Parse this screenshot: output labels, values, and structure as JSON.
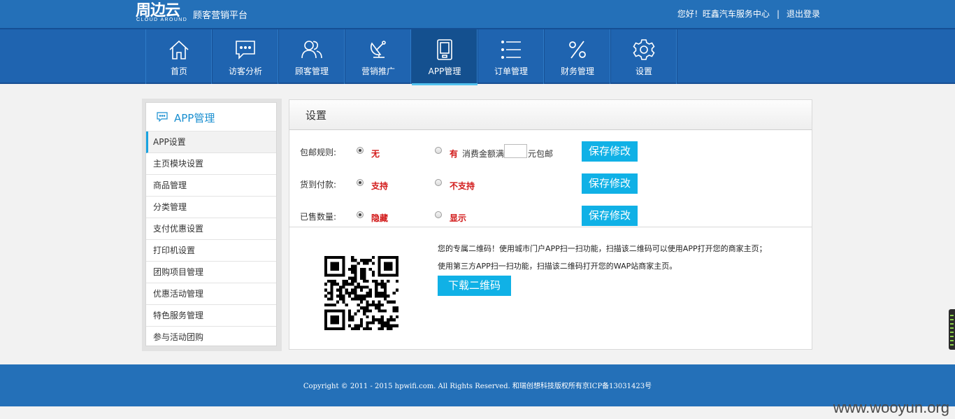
{
  "header": {
    "logo_main": "周边云",
    "logo_sub": "CLOUD  AROUND",
    "logo_tagline": "顾客营销平台",
    "greeting": "您好！旺鑫汽车服务中心",
    "separator": "|",
    "logout": "退出登录"
  },
  "nav": {
    "items": [
      {
        "label": "首页",
        "icon": "home-icon"
      },
      {
        "label": "访客分析",
        "icon": "chat-icon"
      },
      {
        "label": "顾客管理",
        "icon": "users-icon"
      },
      {
        "label": "营销推广",
        "icon": "satellite-icon"
      },
      {
        "label": "APP管理",
        "icon": "tablet-icon"
      },
      {
        "label": "订单管理",
        "icon": "list-icon"
      },
      {
        "label": "财务管理",
        "icon": "percent-icon"
      },
      {
        "label": "设置",
        "icon": "gear-icon"
      }
    ],
    "active_index": 4
  },
  "sidebar": {
    "title": "APP管理",
    "items": [
      {
        "label": "APP设置"
      },
      {
        "label": "主页模块设置"
      },
      {
        "label": "商品管理"
      },
      {
        "label": "分类管理"
      },
      {
        "label": "支付优惠设置"
      },
      {
        "label": "打印机设置"
      },
      {
        "label": "团购项目管理"
      },
      {
        "label": "优惠活动管理"
      },
      {
        "label": "特色服务管理"
      },
      {
        "label": "参与活动团购"
      }
    ],
    "active_index": 0
  },
  "content": {
    "title": "设置",
    "settings": [
      {
        "label": "包邮规则:",
        "option1": "无",
        "option2": "有",
        "option1_checked": true,
        "note_before": "消费金额满",
        "note_after": "元包邮",
        "input_value": "",
        "save": "保存修改"
      },
      {
        "label": "货到付款:",
        "option1": "支持",
        "option2": "不支持",
        "option1_checked": true,
        "save": "保存修改"
      },
      {
        "label": "已售数量:",
        "option1": "隐藏",
        "option2": "显示",
        "option1_checked": true,
        "save": "保存修改"
      }
    ],
    "qr": {
      "text1": "您的专属二维码！使用城市门户APP扫一扫功能，扫描该二维码可以使用APP打开您的商家主页；",
      "text2": "使用第三方APP扫一扫功能，扫描该二维码打开您的WAP站商家主页。",
      "download": "下载二维码"
    }
  },
  "footer": {
    "copyright": "Copyright © 2011 - 2015 hpwifi.com. All Rights Reserved. 和瑞创想科技版权所有京ICP备13031423号"
  },
  "watermark": "www.wooyun.org",
  "colors": {
    "header_blue": "#2470b8",
    "nav_blue": "#1f64b0",
    "accent_cyan": "#10b1e6",
    "option_red": "#d21a1a"
  }
}
